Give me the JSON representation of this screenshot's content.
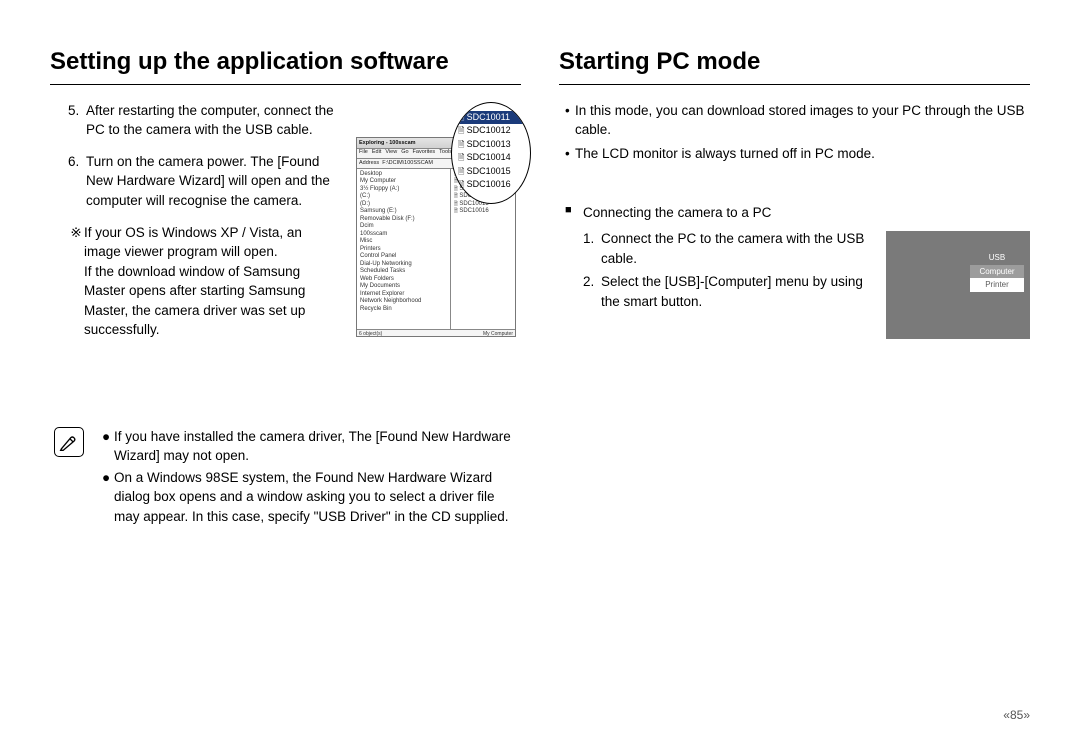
{
  "left": {
    "heading": "Setting up the application software",
    "steps": [
      {
        "n": "5.",
        "text": "After restarting the computer, connect the PC to the camera with the USB cable."
      },
      {
        "n": "6.",
        "text": "Turn on the camera power. The [Found New Hardware Wizard] will open and the computer will recognise the camera."
      }
    ],
    "subnote_sym": "※",
    "subnote_lines": [
      "If your OS is Windows XP / Vista, an image viewer program will open.",
      "If the download window of Samsung Master opens after starting Samsung Master, the camera driver was set up successfully."
    ],
    "notes": [
      "If you have installed the camera driver, The [Found New Hardware Wizard] may not open.",
      "On a Windows 98SE system, the Found New Hardware Wizard dialog box opens and a window asking you to select a driver file may appear. In this case, specify \"USB Driver\" in the CD supplied."
    ]
  },
  "explorer": {
    "title": "Exploring - 100sscam",
    "menus": [
      "File",
      "Edit",
      "View",
      "Go",
      "Favorites",
      "Tools"
    ],
    "addr_label": "Address",
    "addr_value": "F:\\DCIM\\100SSCAM",
    "tree": [
      "Desktop",
      " My Computer",
      "  3½ Floppy (A:)",
      "  (C:)",
      "  (D:)",
      "  Samsung (E:)",
      "  Removable Disk (F:)",
      "   Dcim",
      "    100sscam",
      "   Misc",
      "  Printers",
      "  Control Panel",
      "  Dial-Up Networking",
      "  Scheduled Tasks",
      "  Web Folders",
      " My Documents",
      " Internet Explorer",
      " Network Neighborhood",
      " Recycle Bin"
    ],
    "list": [
      "SDC10011",
      "SDC10012",
      "SDC10013",
      "SDC10014",
      "SDC10015",
      "SDC10016"
    ],
    "status_left": "6 object(s)",
    "status_right": "My Computer",
    "callout": [
      "SDC10011",
      "SDC10012",
      "SDC10013",
      "SDC10014",
      "SDC10015",
      "SDC10016"
    ]
  },
  "right": {
    "heading": "Starting PC mode",
    "intro": [
      "In this mode, you can download stored images to your PC through the USB cable.",
      "The LCD monitor is always turned off in PC mode."
    ],
    "sub_heading": "Connecting the camera to a PC",
    "steps": [
      {
        "n": "1.",
        "text": "Connect the PC to the camera with the USB cable."
      },
      {
        "n": "2.",
        "text": "Select the [USB]-[Computer] menu by using the smart button."
      }
    ]
  },
  "lcd": {
    "title": "USB",
    "items": [
      "Computer",
      "Printer"
    ],
    "selected_index": 0
  },
  "page_number": "85"
}
